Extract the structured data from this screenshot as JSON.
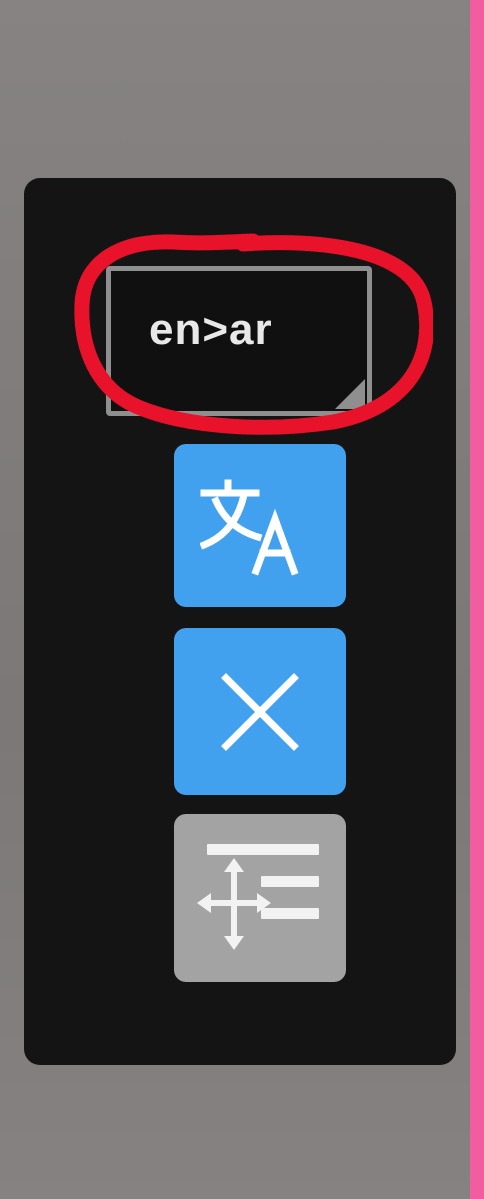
{
  "translator_panel": {
    "language_pair": "en>ar",
    "icons": {
      "translate": "translate-icon",
      "close": "close-icon",
      "move": "move-icon"
    },
    "colors": {
      "panel_background": "#141414",
      "action_button": "#42a1ee",
      "disabled_button": "#a3a3a3",
      "highlight_annotation": "#e8122a",
      "edge_accent": "#f15d9e"
    }
  }
}
